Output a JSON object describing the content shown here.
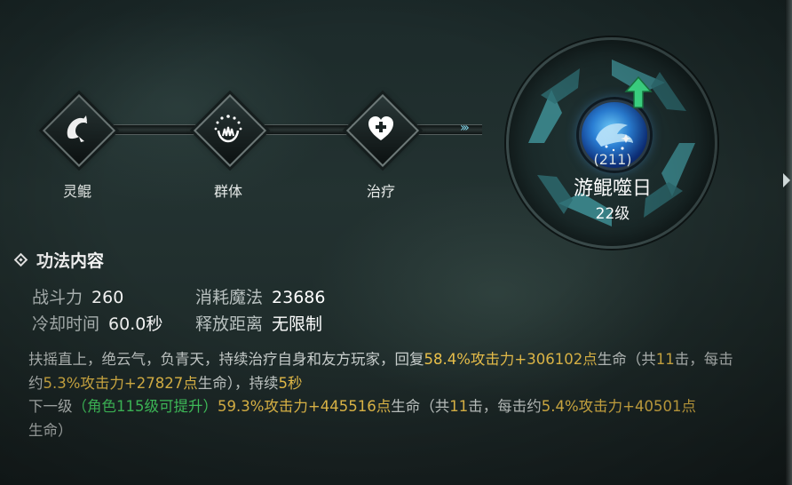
{
  "colors": {
    "highlight": "#ecc24b",
    "unlock": "#47d665",
    "text": "#c9cfcd"
  },
  "path_nodes": [
    {
      "label": "灵鲲",
      "icon": "leaping-fish-icon"
    },
    {
      "label": "群体",
      "icon": "group-aura-icon"
    },
    {
      "label": "治疗",
      "icon": "heal-heart-icon"
    }
  ],
  "skill": {
    "count": "(211)",
    "name": "游鲲噬日",
    "level": "22级",
    "icon": "whale-orb-icon",
    "upgrade_icon": "up-arrow-icon"
  },
  "section_title": "功法内容",
  "stats": {
    "power_label": "战斗力",
    "power_value": "260",
    "mana_label": "消耗魔法",
    "mana_value": "23686",
    "cooldown_label": "冷却时间",
    "cooldown_value": "60.0秒",
    "range_label": "释放距离",
    "range_value": "无限制"
  },
  "description": {
    "part1": "扶摇直上，绝云气，负青天，持续治疗自身和友方玩家，回复",
    "heal_percent": "58.4%攻击力+306102点",
    "part2": "生命（共",
    "hits": "11",
    "part3": "击，每击约",
    "per_hit": "5.3%攻击力+27827点",
    "part4": "生命），持续",
    "duration": "5秒"
  },
  "next_level": {
    "label": "下一级",
    "paren_open": "（",
    "requirement": "角色115级可提升",
    "paren_close": "）",
    "heal_percent": "59.3%攻击力+445516点",
    "part2": "生命（共",
    "hits": "11",
    "part3": "击，每击约",
    "per_hit": "5.4%攻击力+40501点",
    "part4": "生命）"
  }
}
